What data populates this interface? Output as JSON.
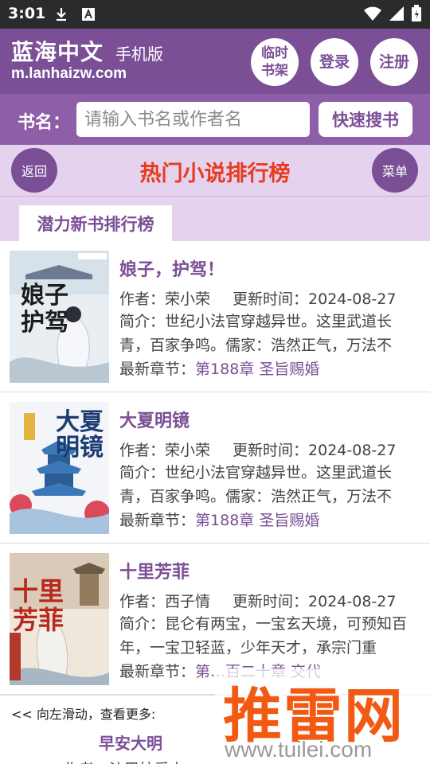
{
  "status_bar": {
    "time": "3:01"
  },
  "header": {
    "brand": "蓝海中文",
    "brand_sub": "手机版",
    "domain": "m.lanhaizw.com",
    "bookshelf_label": "临时书架",
    "login_label": "登录",
    "register_label": "注册"
  },
  "search": {
    "label": "书名：",
    "placeholder": "请输入书名或作者名",
    "button": "快速搜书"
  },
  "titlebar": {
    "back": "返回",
    "title": "热门小说排行榜",
    "menu": "菜单"
  },
  "tab": {
    "label": "潜力新书排行榜"
  },
  "labels": {
    "author": "作者：",
    "updated": "更新时间：",
    "intro": "简介：",
    "latest": "最新章节："
  },
  "books": [
    {
      "title": "娘子，护驾！",
      "author": "荣小荣",
      "updated": "2024-08-27",
      "intro": "世纪小法官穿越异世。这里武道长青，百家争鸣。儒家：浩然正气，万法不",
      "latest": "第188章 圣旨赐婚",
      "cover_text": "娘子护驾"
    },
    {
      "title": "大夏明镜",
      "author": "荣小荣",
      "updated": "2024-08-27",
      "intro": "世纪小法官穿越异世。这里武道长青，百家争鸣。儒家：浩然正气，万法不",
      "latest": "第188章 圣旨赐婚",
      "cover_text": "大夏明镜"
    },
    {
      "title": "十里芳菲",
      "author": "西子情",
      "updated": "2024-08-27",
      "intro": "昆仑有两宝，一宝玄天境，可预知百年，一宝卫轻蓝，少年天才，承宗门重",
      "latest": "第…百二十章 交代",
      "cover_text": "十里芳菲"
    }
  ],
  "more": {
    "hint": "<< 向左滑动，查看更多:",
    "next_title": "早安大明",
    "next_author": "作者：沙巴拉爱上"
  },
  "watermark": {
    "big": "推雷网",
    "url": "www.tuilei.com"
  },
  "colors": {
    "primary": "#7b4f96",
    "title_red": "#e83a1c",
    "watermark": "#f25a14"
  }
}
